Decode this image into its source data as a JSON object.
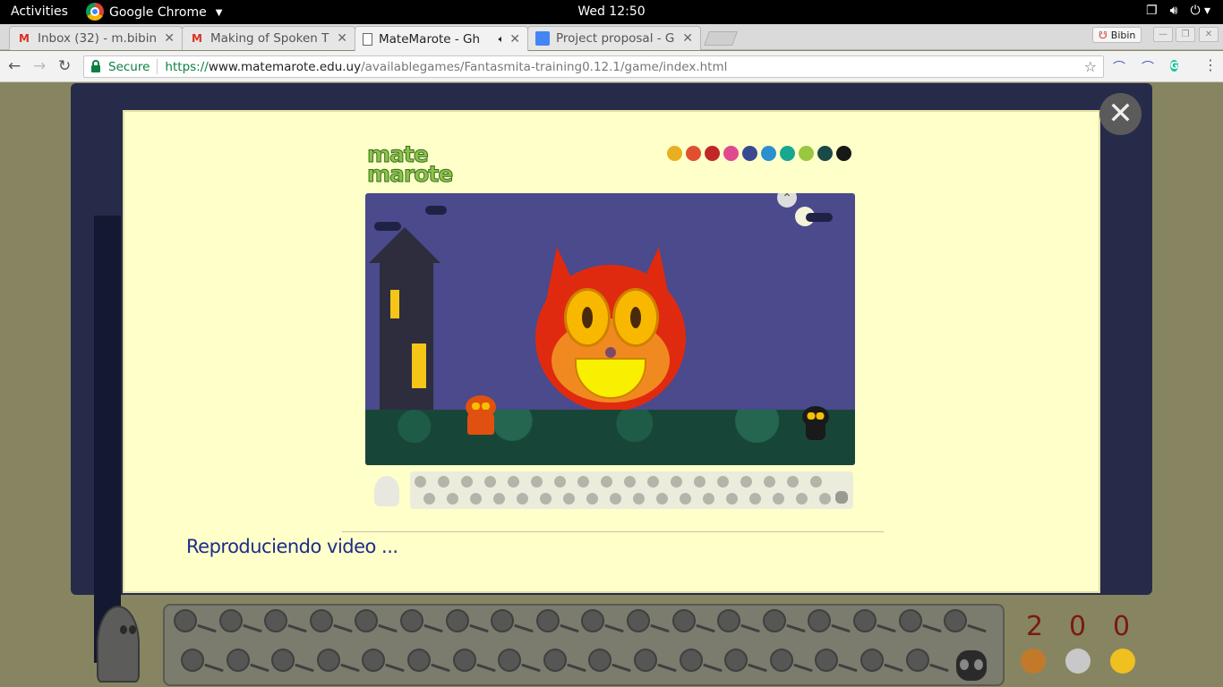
{
  "topbar": {
    "activities": "Activities",
    "app_name": "Google Chrome",
    "clock": "Wed 12:50"
  },
  "tabs": [
    {
      "title": "Inbox (32) - m.bibin",
      "icon": "gmail-icon",
      "active": false
    },
    {
      "title": "Making of Spoken T",
      "icon": "gmail-icon",
      "active": false
    },
    {
      "title": "MateMarote - Gh",
      "icon": "page-icon",
      "active": true,
      "audio": true
    },
    {
      "title": "Project proposal - G",
      "icon": "docs-icon",
      "active": false
    }
  ],
  "profile": {
    "name": "Bibin"
  },
  "toolbar": {
    "secure_label": "Secure",
    "url_scheme": "https://",
    "url_host": "www.matemarote.edu.uy",
    "url_path": "/availablegames/Fantasmita-training0.12.1/game/index.html"
  },
  "game": {
    "logo_line1": "mate",
    "logo_line2": "marote",
    "palette_colors": [
      "#e8b020",
      "#e05030",
      "#c02828",
      "#e04890",
      "#3a4a90",
      "#2a90d0",
      "#18a890",
      "#98c840",
      "#1a4a48",
      "#181818"
    ],
    "status_text": "Reproduciendo video ...",
    "scores": [
      {
        "value": "2",
        "medal": "bronze",
        "color": "#c27a2a"
      },
      {
        "value": "0",
        "medal": "silver",
        "color": "#c8c8c8"
      },
      {
        "value": "0",
        "medal": "gold",
        "color": "#f0c020"
      }
    ]
  },
  "colors": {
    "stage_bg": "#262b4a",
    "modal_bg": "#ffffc9",
    "status_text": "#1e2c8c",
    "secure_green": "#0b8043"
  }
}
